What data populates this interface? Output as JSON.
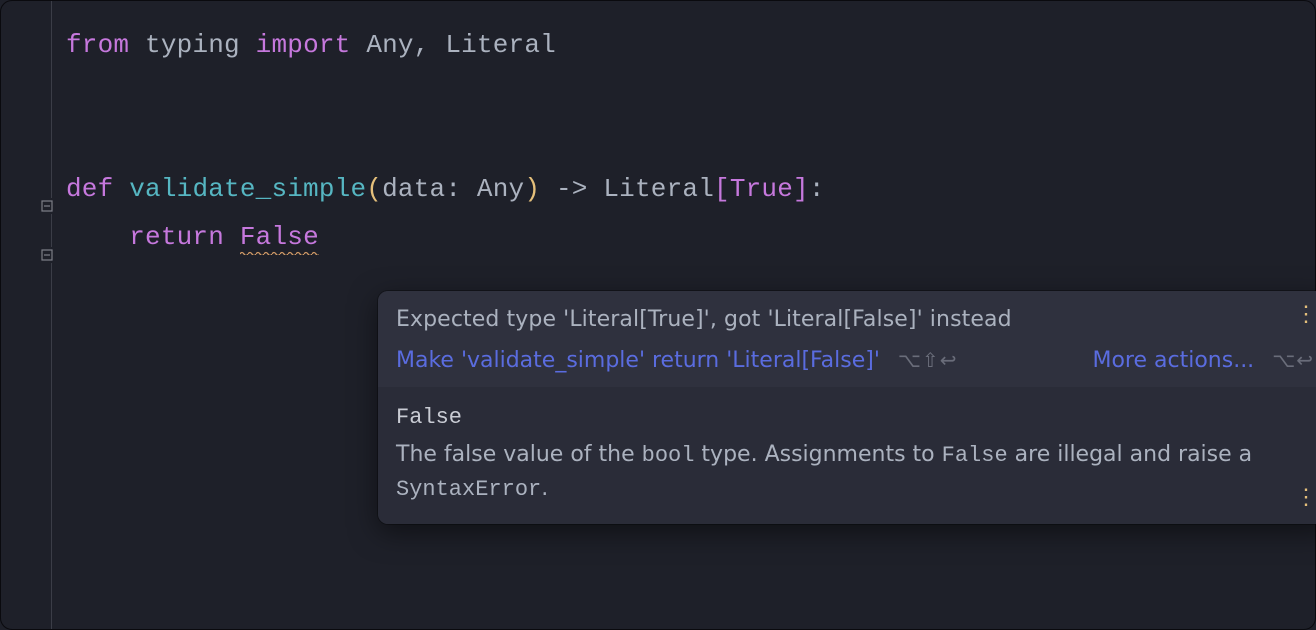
{
  "code": {
    "line1": {
      "kw1": "from",
      "module": "typing",
      "kw2": "import",
      "imports": "Any, Literal"
    },
    "line4": {
      "kw": "def",
      "fn_name": "validate_simple",
      "lparen": "(",
      "param": "data",
      "colon1": ":",
      "ptype": " Any",
      "rparen": ")",
      "arrow": " -> ",
      "ret_type": "Literal",
      "lbracket": "[",
      "ret_val": "True",
      "rbracket": "]",
      "end_colon": ":"
    },
    "line5": {
      "indent": "    ",
      "kw": "return",
      "value": "False"
    }
  },
  "popup": {
    "error_message": "Expected type 'Literal[True]', got 'Literal[False]' instead",
    "quickfix_label": "Make 'validate_simple' return 'Literal[False]'",
    "quickfix_shortcut": "⌥⇧↩",
    "more_actions_label": "More actions...",
    "more_actions_shortcut": "⌥↩",
    "doc_symbol": "False",
    "doc_body_1": "The false value of the ",
    "doc_body_mono1": "bool",
    "doc_body_2": " type. Assignments to ",
    "doc_body_mono2": "False",
    "doc_body_3": " are illegal and raise a ",
    "doc_body_mono3": "SyntaxError",
    "doc_body_4": "."
  }
}
